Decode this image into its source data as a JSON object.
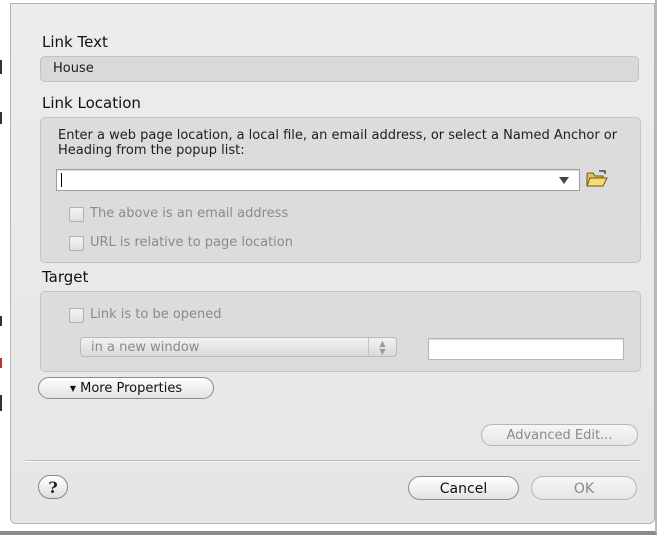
{
  "sections": {
    "link_text_title": "Link Text",
    "link_location_title": "Link Location",
    "target_title": "Target"
  },
  "link_text": {
    "value": "House"
  },
  "link_location": {
    "instructions": "Enter a web page location, a local file, an email address, or select a Named Anchor or Heading from the popup list:",
    "url_value": "",
    "email_checkbox_label": "The above is an email address",
    "relative_checkbox_label": "URL is relative to page location",
    "email_checked": false,
    "relative_checked": false,
    "browse_icon": "open-folder-icon"
  },
  "target": {
    "open_checkbox_label": "Link is to be opened",
    "open_checked": false,
    "window_select_value": "in a new window",
    "frame_name_value": ""
  },
  "buttons": {
    "more_properties": "More Properties",
    "advanced_edit": "Advanced Edit...",
    "help": "?",
    "cancel": "Cancel",
    "ok": "OK"
  },
  "icons": {
    "more_properties_arrow": "triangle-down-icon",
    "dropdown_arrow": "triangle-down-icon",
    "stepper": "up-down-arrows-icon"
  }
}
